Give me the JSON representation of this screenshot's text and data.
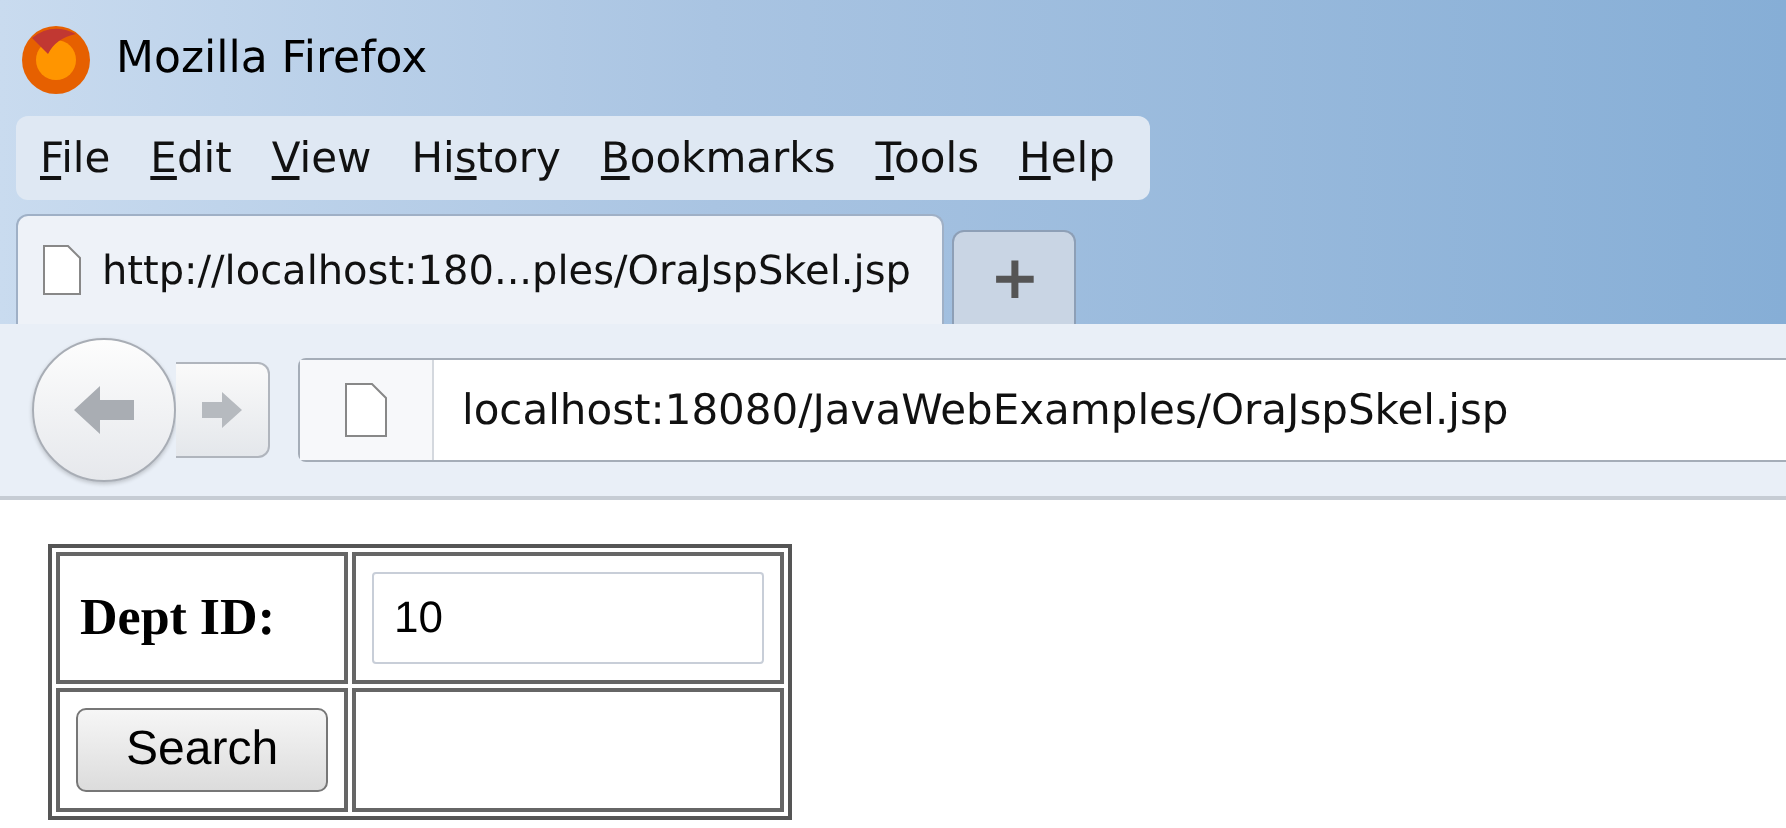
{
  "window": {
    "title": "Mozilla Firefox"
  },
  "menu": [
    {
      "key": "F",
      "after": "ile"
    },
    {
      "key": "E",
      "after": "dit"
    },
    {
      "key": "V",
      "after": "iew"
    },
    {
      "before": "Hi",
      "key": "s",
      "after": "tory"
    },
    {
      "key": "B",
      "after": "ookmarks"
    },
    {
      "key": "T",
      "after": "ools"
    },
    {
      "key": "H",
      "after": "elp"
    }
  ],
  "tabs": [
    {
      "label": "http://localhost:180...ples/OraJspSkel.jsp",
      "selected": true
    }
  ],
  "new_tab": "+",
  "address_bar": {
    "value": "localhost:18080/JavaWebExamples/OraJspSkel.jsp"
  },
  "form": {
    "label": "Dept ID:",
    "field_value": "10",
    "button": "Search"
  }
}
